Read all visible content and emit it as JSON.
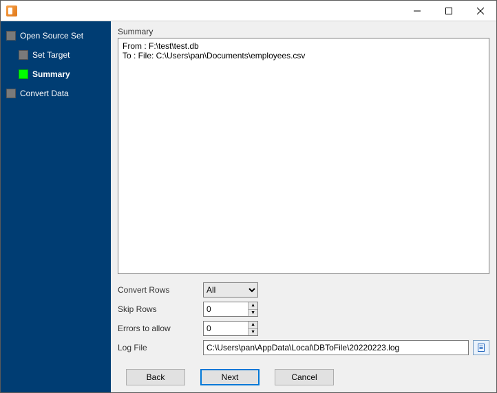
{
  "titlebar": {
    "title": ""
  },
  "sidebar": {
    "steps": [
      {
        "label": "Open Source Set",
        "indent": false,
        "current": false
      },
      {
        "label": "Set Target",
        "indent": true,
        "current": false
      },
      {
        "label": "Summary",
        "indent": true,
        "current": true
      },
      {
        "label": "Convert Data",
        "indent": false,
        "current": false
      }
    ]
  },
  "main": {
    "summary_title": "Summary",
    "summary_text": "From : F:\\test\\test.db\nTo : File: C:\\Users\\pan\\Documents\\employees.csv",
    "convert_rows": {
      "label": "Convert Rows",
      "value": "All",
      "options": [
        "All"
      ]
    },
    "skip_rows": {
      "label": "Skip Rows",
      "value": "0"
    },
    "errors_allow": {
      "label": "Errors to allow",
      "value": "0"
    },
    "log_file": {
      "label": "Log File",
      "value": "C:\\Users\\pan\\AppData\\Local\\DBToFile\\20220223.log"
    }
  },
  "footer": {
    "back": "Back",
    "next": "Next",
    "cancel": "Cancel"
  }
}
